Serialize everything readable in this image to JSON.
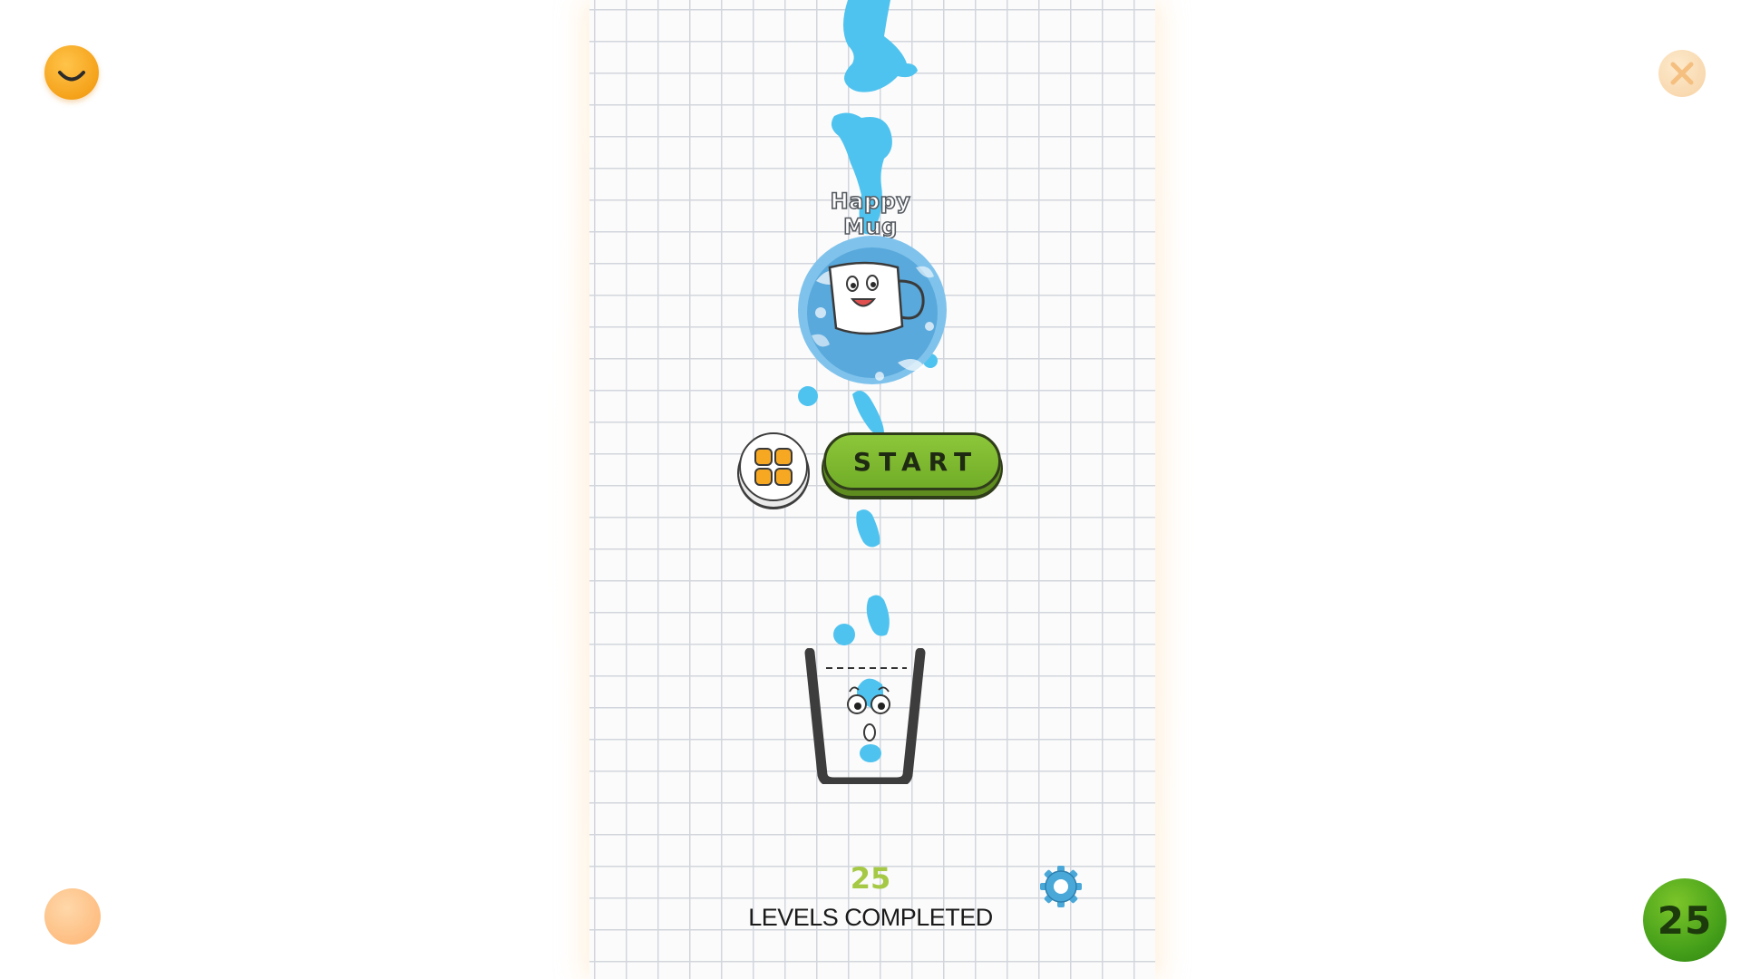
{
  "game": {
    "title": "Happy Mug",
    "start_label": "START",
    "levels_completed_count": "25",
    "levels_completed_label": "LEVELS COMPLETED",
    "level_badge": "25"
  },
  "icons": {
    "top_left": "smile-icon",
    "top_right": "close-icon",
    "bottom_left": "sound-icon",
    "menu": "grid-menu-icon",
    "settings": "gear-icon"
  },
  "colors": {
    "water": "#4fc3ef",
    "start_button": "#7cb82f",
    "orange_button": "#f5a21a",
    "green_badge": "#47a11a",
    "levels_count": "#a5c944"
  }
}
